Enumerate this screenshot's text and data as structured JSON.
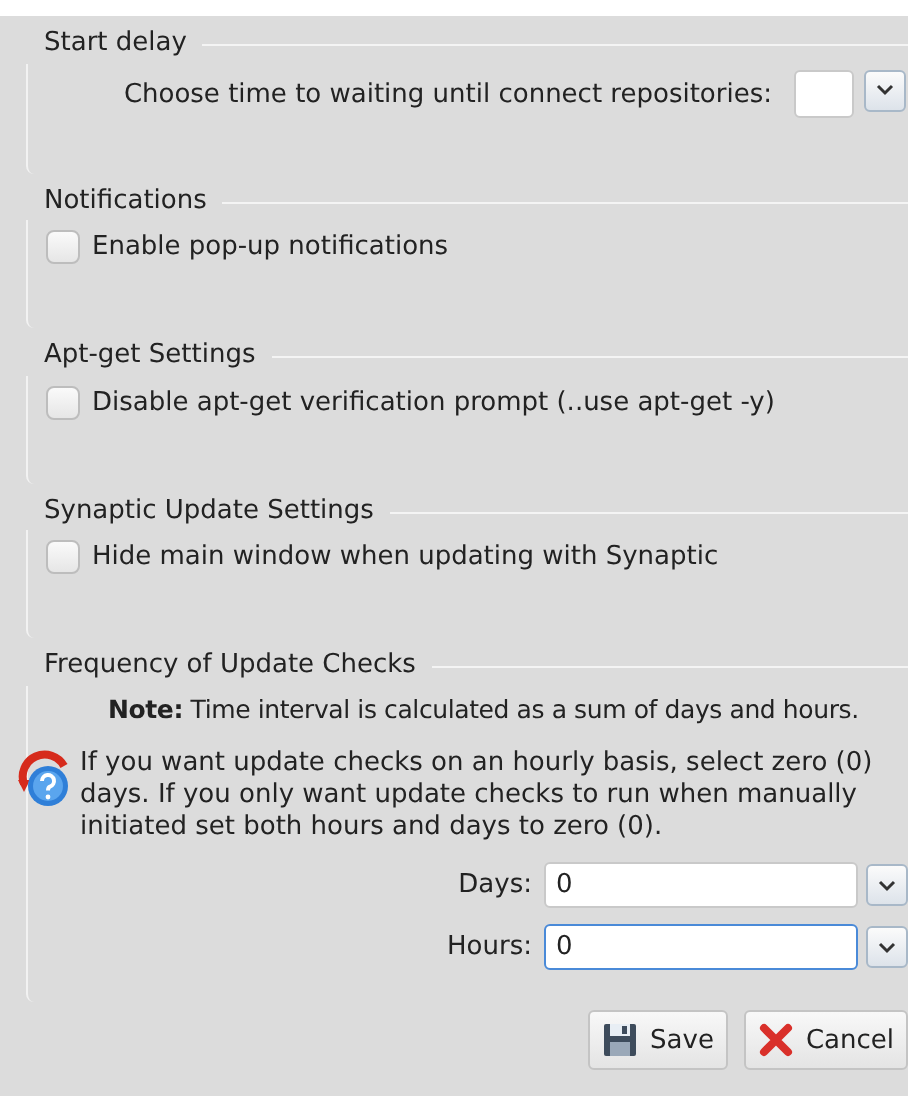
{
  "sections": [
    {
      "kind": "combo",
      "title": "Start delay",
      "label": "Choose time to waiting until connect repositories:"
    },
    {
      "kind": "checkbox",
      "title": "Notifications",
      "label": "Enable pop-up notifications",
      "checked": false
    },
    {
      "kind": "checkbox",
      "title": "Apt-get Settings",
      "label": "Disable apt-get verification prompt  (..use apt-get -y)",
      "checked": false
    },
    {
      "kind": "checkbox",
      "title": "Synaptic Update Settings",
      "label": "Hide main window when updating with Synaptic",
      "checked": false
    },
    {
      "kind": "frequency",
      "title": "Frequency of Update Checks",
      "note": "**Note:**  Time interval is calculated as a sum of days and hours.",
      "info": "If you want update checks on an hourly basis, select zero (0) days. If you only want update checks to run when manually initiated set both hours and days to zero (0).",
      "fields": [
        {
          "label": "Days:",
          "value": "0",
          "focused": false
        },
        {
          "label": "Hours:",
          "value": "0",
          "focused": true
        }
      ]
    }
  ],
  "buttons": [
    {
      "kind": "save",
      "label": "Save"
    },
    {
      "kind": "cancel",
      "label": "Cancel"
    }
  ]
}
